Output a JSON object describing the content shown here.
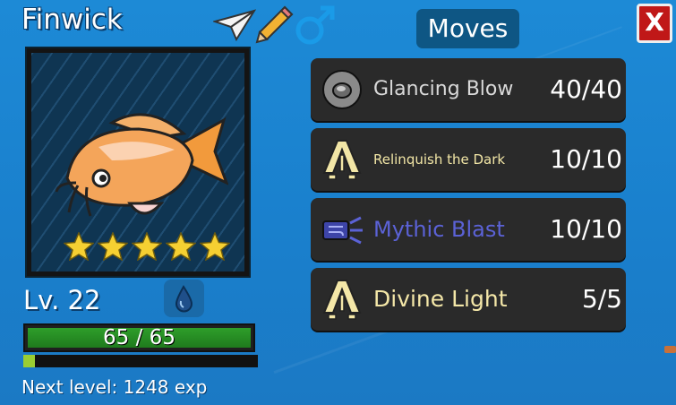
{
  "monster": {
    "name": "Finwick",
    "level": "Lv. 22",
    "stars": 5,
    "hp_text": "65 / 65",
    "hp_fraction": 1.0,
    "xp_fraction": 0.05,
    "next_level": "Next level: 1248 exp",
    "element_icon": "water-drop-icon",
    "gender_icon": "male-icon"
  },
  "header_icons": [
    "paper-plane-icon",
    "pencil-icon"
  ],
  "moves_panel": {
    "title": "Moves",
    "close_label": "X",
    "moves": [
      {
        "name": "Glancing Blow",
        "pp": "40/40",
        "icon": "disc-icon",
        "color": "#d9d9d9"
      },
      {
        "name": "Relinquish the Dark",
        "pp": "10/10",
        "icon": "light-rays-icon",
        "color": "#f2e6a6"
      },
      {
        "name": "Mythic Blast",
        "pp": "10/10",
        "icon": "scroll-blast-icon",
        "color": "#5b62d6"
      },
      {
        "name": "Divine Light",
        "pp": "5/5",
        "icon": "light-rays-icon",
        "color": "#f4e7a8"
      }
    ]
  },
  "colors": {
    "background": "#1a80cd",
    "hp_green": "#2e9e2a",
    "close_red": "#c01818",
    "star_yellow": "#f5d032"
  }
}
